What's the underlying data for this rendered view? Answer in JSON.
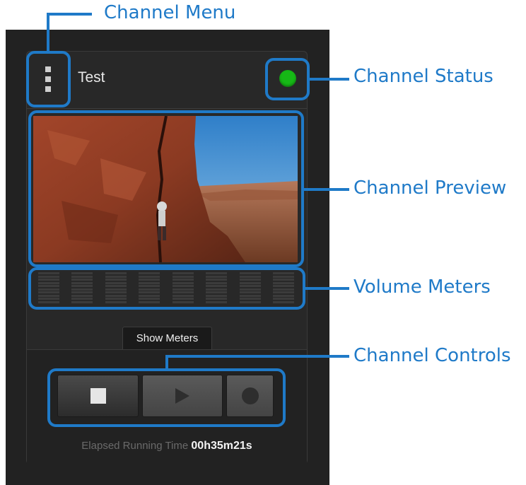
{
  "channel": {
    "name": "Test",
    "status_color": "#16b816",
    "show_meters_label": "Show Meters",
    "elapsed_label": "Elapsed Running Time",
    "elapsed_value": "00h35m21s",
    "meter_count": 8
  },
  "controls": {
    "stop_icon": "stop-icon",
    "play_icon": "play-icon",
    "record_icon": "record-icon"
  },
  "annotations": {
    "menu": "Channel Menu",
    "status": "Channel Status",
    "preview": "Channel Preview",
    "meters": "Volume Meters",
    "controls": "Channel Controls"
  },
  "colors": {
    "annotation": "#1f7ac8",
    "panel_bg": "#222222"
  }
}
